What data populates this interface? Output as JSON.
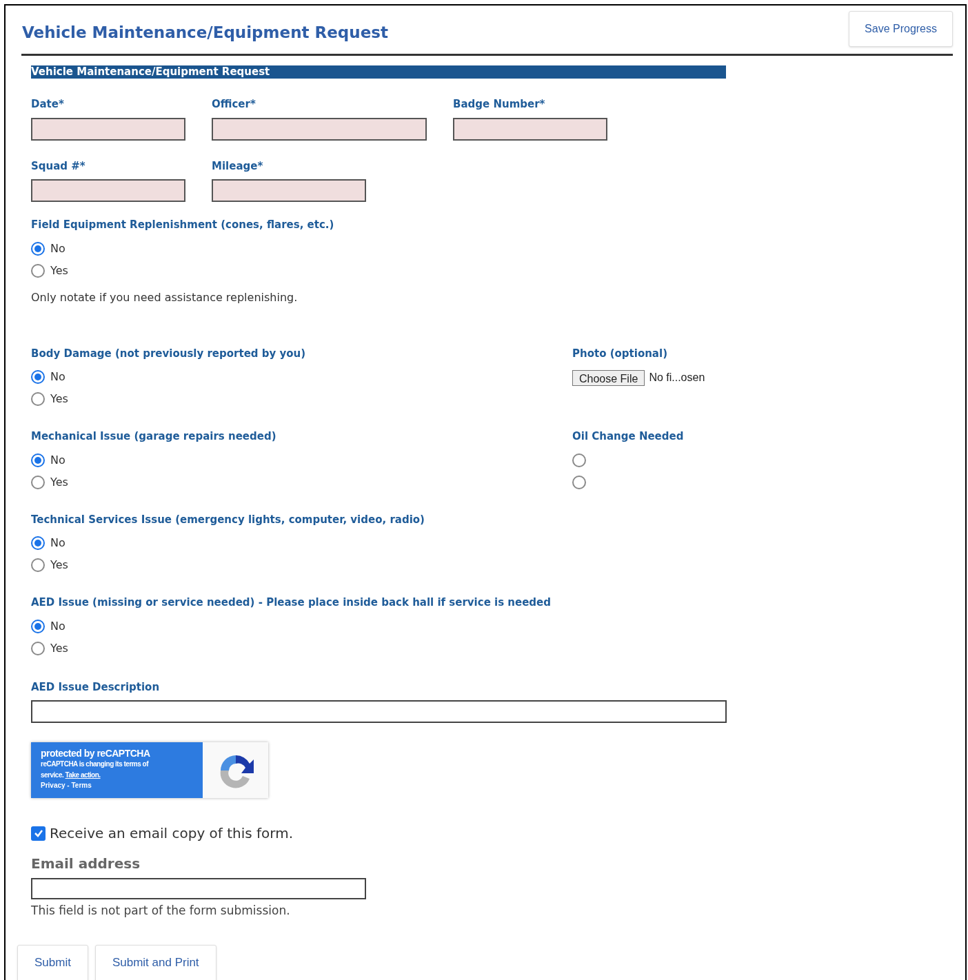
{
  "header": {
    "title": "Vehicle Maintenance/Equipment Request",
    "save_button": "Save Progress"
  },
  "section_title": "Vehicle Maintenance/Equipment Request",
  "field_rows": [
    [
      {
        "label": "Date*"
      },
      {
        "label": "Officer*"
      },
      {
        "label": "Badge Number*"
      }
    ],
    [
      {
        "label": "Squad #*"
      },
      {
        "label": "Mileage*"
      }
    ]
  ],
  "questions": [
    {
      "label": "Field Equipment Replenishment (cones, flares, etc.)",
      "options": [
        {
          "label": "No",
          "selected": true
        },
        {
          "label": "Yes",
          "selected": false
        }
      ],
      "note": "Only notate if you need assistance replenishing."
    },
    {
      "label": "Body Damage (not previously reported by you)",
      "options": [
        {
          "label": "No",
          "selected": true
        },
        {
          "label": "Yes",
          "selected": false
        }
      ],
      "side": {
        "kind": "file",
        "label": "Photo (optional)",
        "button": "Choose File",
        "status": "No fi...osen"
      }
    },
    {
      "label": "Mechanical Issue (garage repairs needed)",
      "options": [
        {
          "label": "No",
          "selected": true
        },
        {
          "label": "Yes",
          "selected": false
        }
      ],
      "side": {
        "kind": "radio",
        "label": "Oil Change Needed",
        "options": [
          {
            "selected": false
          },
          {
            "selected": false
          }
        ]
      }
    },
    {
      "label": "Technical Services Issue (emergency lights, computer, video, radio)",
      "options": [
        {
          "label": "No",
          "selected": true
        },
        {
          "label": "Yes",
          "selected": false
        }
      ]
    },
    {
      "label": "AED Issue (missing or service needed) - Please place inside back hall if service is needed",
      "options": [
        {
          "label": "No",
          "selected": true
        },
        {
          "label": "Yes",
          "selected": false
        }
      ]
    }
  ],
  "aed_description": {
    "label": "AED Issue Description"
  },
  "recaptcha": {
    "title": "protected by reCAPTCHA",
    "message": "reCAPTCHA is changing its terms of service.",
    "link": "Take action.",
    "footer": "Privacy - Terms"
  },
  "email_copy": {
    "label": "Receive an email copy of this form.",
    "checked": true
  },
  "email": {
    "label": "Email address",
    "hint": "This field is not part of the form submission."
  },
  "buttons": [
    "Submit",
    "Submit and Print"
  ]
}
